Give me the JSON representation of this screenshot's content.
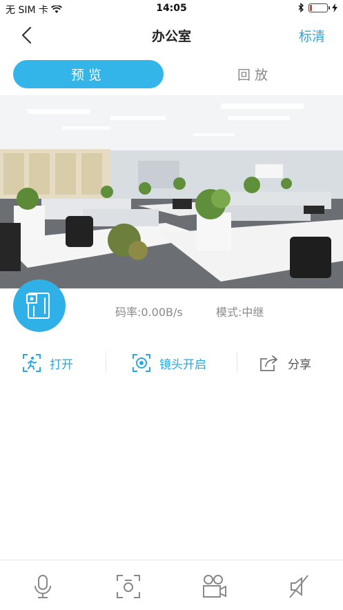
{
  "status_bar": {
    "carrier": "无 SIM 卡",
    "time": "14:05",
    "battery_level": 0.15
  },
  "nav": {
    "title": "办公室",
    "quality": "标清"
  },
  "tabs": [
    {
      "label": "预览",
      "active": true
    },
    {
      "label": "回放",
      "active": false
    }
  ],
  "info": {
    "bitrate": "码率:0.00B/s",
    "mode": "模式:中继"
  },
  "actions": [
    {
      "label": "打开",
      "icon": "door-open-icon"
    },
    {
      "label": "镜头开启",
      "icon": "lens-icon"
    },
    {
      "label": "分享",
      "icon": "share-icon"
    }
  ],
  "bottom_bar": [
    "microphone-icon",
    "screenshot-icon",
    "record-video-icon",
    "mute-icon"
  ],
  "colors": {
    "accent": "#33b5e9",
    "icon_gray": "#8a8a8a"
  }
}
